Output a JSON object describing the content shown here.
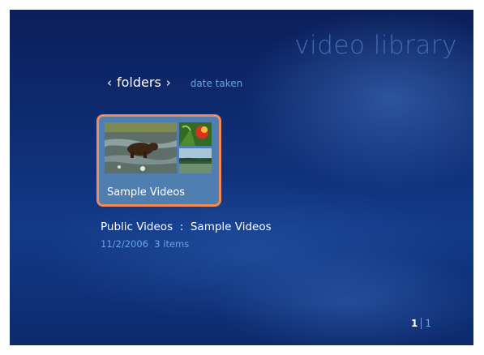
{
  "app": {
    "title": "video library"
  },
  "nav": {
    "current": "folders",
    "prev_icon": "‹",
    "next_icon": "›",
    "next_option": "date taken"
  },
  "tile": {
    "label": "Sample Videos"
  },
  "details": {
    "folder": "Public Videos",
    "separator": ":",
    "subfolder": "Sample Videos",
    "date": "11/2/2006",
    "items": "3 items"
  },
  "pager": {
    "current": "1",
    "total": "1"
  },
  "colors": {
    "accent_text": "#6aa3e3",
    "title": "#3f6bb6",
    "selection_border": "#f08a5a",
    "background": "#0f2c72"
  }
}
